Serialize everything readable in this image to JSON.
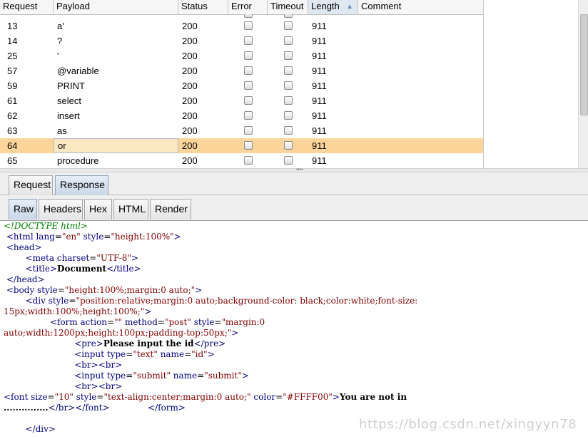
{
  "table": {
    "columns": [
      "Request",
      "Payload",
      "Status",
      "Error",
      "Timeout",
      "Length",
      "Comment"
    ],
    "sorted_column": "Length",
    "rows": [
      {
        "request": "13",
        "payload": "a'",
        "status": "200",
        "length": "911",
        "error": false,
        "timeout": false,
        "selected": false
      },
      {
        "request": "14",
        "payload": "?",
        "status": "200",
        "length": "911",
        "error": false,
        "timeout": false,
        "selected": false
      },
      {
        "request": "25",
        "payload": "'",
        "status": "200",
        "length": "911",
        "error": false,
        "timeout": false,
        "selected": false
      },
      {
        "request": "57",
        "payload": "@variable",
        "status": "200",
        "length": "911",
        "error": false,
        "timeout": false,
        "selected": false
      },
      {
        "request": "59",
        "payload": "PRINT",
        "status": "200",
        "length": "911",
        "error": false,
        "timeout": false,
        "selected": false
      },
      {
        "request": "61",
        "payload": "select",
        "status": "200",
        "length": "911",
        "error": false,
        "timeout": false,
        "selected": false
      },
      {
        "request": "62",
        "payload": "insert",
        "status": "200",
        "length": "911",
        "error": false,
        "timeout": false,
        "selected": false
      },
      {
        "request": "63",
        "payload": "as",
        "status": "200",
        "length": "911",
        "error": false,
        "timeout": false,
        "selected": false
      },
      {
        "request": "64",
        "payload": "or",
        "status": "200",
        "length": "911",
        "error": false,
        "timeout": false,
        "selected": true
      },
      {
        "request": "65",
        "payload": "procedure",
        "status": "200",
        "length": "911",
        "error": false,
        "timeout": false,
        "selected": false
      }
    ],
    "selected_row_color": "#fdd49a"
  },
  "message_tabs": {
    "items": [
      "Request",
      "Response"
    ],
    "active": "Response"
  },
  "view_tabs": {
    "items": [
      "Raw",
      "Headers",
      "Hex",
      "HTML",
      "Render"
    ],
    "active": "Raw"
  },
  "code_lines": [
    [
      [
        "c",
        "<!DOCTYPE html>"
      ]
    ],
    [
      [
        "p",
        " "
      ],
      [
        "t",
        "<html "
      ],
      [
        "a",
        "lang"
      ],
      [
        "p",
        "="
      ],
      [
        "v",
        "\"en\""
      ],
      [
        "a",
        " style"
      ],
      [
        "p",
        "="
      ],
      [
        "v",
        "\"height:100%\""
      ],
      [
        "t",
        ">"
      ]
    ],
    [
      [
        "p",
        " "
      ],
      [
        "t",
        "<head>"
      ]
    ],
    [
      [
        "p",
        "        "
      ],
      [
        "t",
        "<meta "
      ],
      [
        "a",
        "charset"
      ],
      [
        "p",
        "="
      ],
      [
        "v",
        "\"UTF-8\""
      ],
      [
        "t",
        ">"
      ]
    ],
    [
      [
        "p",
        "        "
      ],
      [
        "t",
        "<title>"
      ],
      [
        "b",
        "Document"
      ],
      [
        "t",
        "</title>"
      ]
    ],
    [
      [
        "p",
        " "
      ],
      [
        "t",
        "</head>"
      ]
    ],
    [
      [
        "p",
        " "
      ],
      [
        "t",
        "<body "
      ],
      [
        "a",
        "style"
      ],
      [
        "p",
        "="
      ],
      [
        "v",
        "\"height:100%;margin:0 auto;\""
      ],
      [
        "t",
        ">"
      ]
    ],
    [
      [
        "p",
        "        "
      ],
      [
        "t",
        "<div "
      ],
      [
        "a",
        "style"
      ],
      [
        "p",
        "="
      ],
      [
        "v",
        "\"position:relative;margin:0 auto;background-color: black;color:white;font-size:"
      ]
    ],
    [
      [
        "v",
        "15px;width:100%;height:100%;\""
      ],
      [
        "t",
        ">"
      ]
    ],
    [
      [
        "p",
        "                 "
      ],
      [
        "t",
        "<form "
      ],
      [
        "a",
        "action"
      ],
      [
        "p",
        "="
      ],
      [
        "v",
        "\"\""
      ],
      [
        "a",
        " method"
      ],
      [
        "p",
        "="
      ],
      [
        "v",
        "\"post\""
      ],
      [
        "a",
        " style"
      ],
      [
        "p",
        "="
      ],
      [
        "v",
        "\"margin:0"
      ]
    ],
    [
      [
        "v",
        "auto;width:1200px;height:100px;padding-top:50px;\""
      ],
      [
        "t",
        ">"
      ]
    ],
    [
      [
        "p",
        "                          "
      ],
      [
        "t",
        "<pre>"
      ],
      [
        "b",
        "Please input the id"
      ],
      [
        "t",
        "</pre>"
      ]
    ],
    [
      [
        "p",
        "                          "
      ],
      [
        "t",
        "<input "
      ],
      [
        "a",
        "type"
      ],
      [
        "p",
        "="
      ],
      [
        "v",
        "\"text\""
      ],
      [
        "a",
        " name"
      ],
      [
        "p",
        "="
      ],
      [
        "v",
        "\"id\""
      ],
      [
        "t",
        ">"
      ]
    ],
    [
      [
        "p",
        "                          "
      ],
      [
        "t",
        "<br><br>"
      ]
    ],
    [
      [
        "p",
        "                          "
      ],
      [
        "t",
        "<input "
      ],
      [
        "a",
        "type"
      ],
      [
        "p",
        "="
      ],
      [
        "v",
        "\"submit\""
      ],
      [
        "a",
        " name"
      ],
      [
        "p",
        "="
      ],
      [
        "v",
        "\"submit\""
      ],
      [
        "t",
        ">"
      ]
    ],
    [
      [
        "p",
        "                          "
      ],
      [
        "t",
        "<br><br>"
      ]
    ],
    [
      [
        "t",
        "<font "
      ],
      [
        "a",
        "size"
      ],
      [
        "p",
        "="
      ],
      [
        "v",
        "\"10\""
      ],
      [
        "a",
        " style"
      ],
      [
        "p",
        "="
      ],
      [
        "v",
        "\"text-align:center;margin:0 auto;\""
      ],
      [
        "a",
        " color"
      ],
      [
        "p",
        "="
      ],
      [
        "v",
        "\"#FFFF00\""
      ],
      [
        "t",
        ">"
      ],
      [
        "b",
        "You are not in"
      ]
    ],
    [
      [
        "b",
        "..............."
      ],
      [
        "t",
        "</br></font>"
      ],
      [
        "p",
        "              "
      ],
      [
        "t",
        "</form>"
      ]
    ],
    [
      [
        "p",
        ""
      ]
    ],
    [
      [
        "p",
        "        "
      ],
      [
        "t",
        "</div>"
      ]
    ]
  ],
  "watermark": "https://blog.csdn.net/xingyyn78"
}
